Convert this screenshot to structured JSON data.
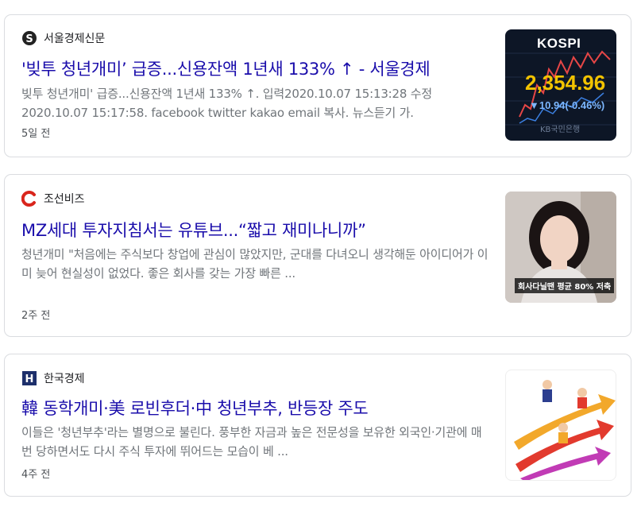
{
  "articles": [
    {
      "source": "서울경제신문",
      "headline": "'빚투 청년개미’ 급증...신용잔액 1년새 133% ↑ - 서울경제",
      "snippet": "빚투 청년개미' 급증...신용잔액 1년새 133% ↑. 입력2020.10.07 15:13:28 수정 2020.10.07 15:17:58. facebook twitter kakao email 복사. 뉴스듣기 가.",
      "time": "5일 전",
      "thumbnail": {
        "label": "KOSPI",
        "value": "2,354.96",
        "change": "▼10.94(-0.46%)",
        "bank": "KB국민은행"
      }
    },
    {
      "source": "조선비즈",
      "headline": "MZ세대 투자지침서는 유튜브...“짧고 재미나니까”",
      "snippet": "청년개미 \"처음에는 주식보다 창업에 관심이 많았지만, 군대를 다녀오니 생각해둔 아이디어가 이미 늦어 현실성이 없었다. 좋은 회사를 갖는 가장 빠른 ...",
      "time": "2주 전",
      "thumbnail": {
        "caption": "회사다닐땐 평균 80% 저축"
      }
    },
    {
      "source": "한국경제",
      "headline": "韓 동학개미·美 로빈후더·中 청년부추, 반등장 주도",
      "snippet": "이들은 '청년부추'라는 별명으로 불린다. 풍부한 자금과 높은 전문성을 보유한 외국인·기관에 매번 당하면서도 다시 주식 투자에 뛰어드는 모습이 베 ...",
      "time": "4주 전"
    }
  ],
  "colors": {
    "headline": "#1a0dab",
    "snippet": "#70757a",
    "kospi_value": "#f2c300",
    "kospi_change": "#7db7ff"
  },
  "icons": [
    "seoul-economy-logo-icon",
    "chosun-biz-logo-icon",
    "hankyung-logo-icon"
  ]
}
